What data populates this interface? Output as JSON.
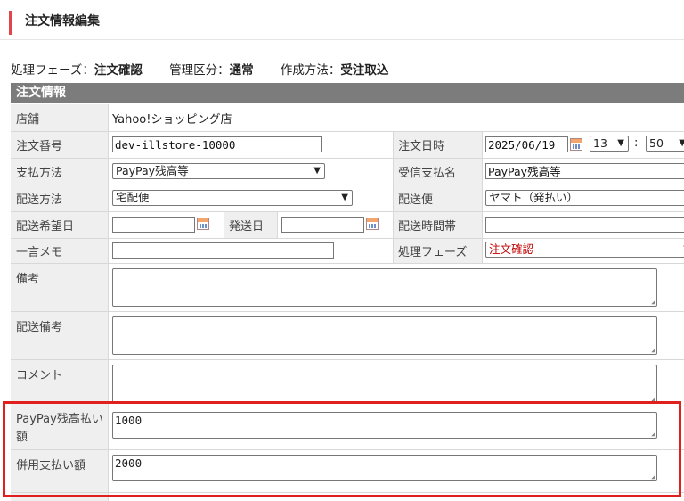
{
  "page": {
    "title": "注文情報編集"
  },
  "status": {
    "phase_label": "処理フェーズ：",
    "phase_value": "注文確認",
    "mgmt_label": "管理区分：",
    "mgmt_value": "通常",
    "method_label": "作成方法：",
    "method_value": "受注取込"
  },
  "section": {
    "title": "注文情報"
  },
  "form": {
    "store_label": "店舗",
    "store_value": "Yahoo!ショッピング店",
    "order_no_label": "注文番号",
    "order_no_value": "dev-illstore-10000",
    "order_date_label": "注文日時",
    "order_date_value": "2025/06/19",
    "order_hour": "13",
    "time_sep": ":",
    "order_min": "50",
    "payment_label": "支払方法",
    "payment_value": "PayPay残高等",
    "recv_payment_label": "受信支払名",
    "recv_payment_value": "PayPay残高等",
    "shipping_method_label": "配送方法",
    "shipping_method_value": "宅配便",
    "carrier_label": "配送便",
    "carrier_value": "ヤマト（発払い）",
    "desired_date_label": "配送希望日",
    "ship_date_label": "発送日",
    "time_slot_label": "配送時間帯",
    "memo_label": "一言メモ",
    "phase_label": "処理フェーズ",
    "phase_value": "注文確認",
    "remarks_label": "備考",
    "delivery_remarks_label": "配送備考",
    "comment_label": "コメント",
    "paypay_amount_label": "PayPay残高払い額",
    "paypay_amount_value": "1000",
    "combined_amount_label": "併用支払い額",
    "combined_amount_value": "2000"
  },
  "colors": {
    "accent": "#e0474c",
    "header_bg": "#7c7c7c",
    "label_bg": "#efefef",
    "highlight": "#e0201c",
    "phase_text": "#c00000"
  }
}
